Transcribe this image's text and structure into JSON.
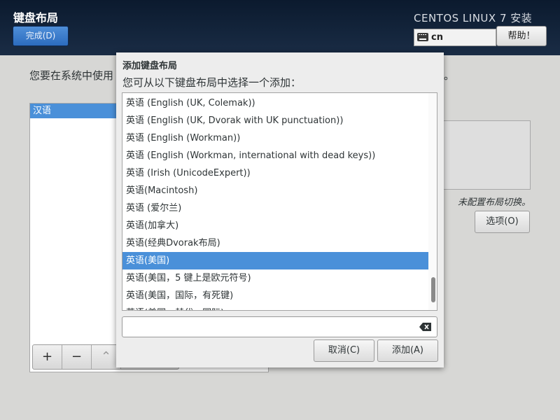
{
  "header": {
    "title": "键盘布局",
    "done_label": "完成(D)",
    "product_title": "CENTOS LINUX 7 安装",
    "keyboard_indicator": "cn",
    "help_label": "帮助！"
  },
  "background": {
    "instruction": "您要在系统中使用",
    "instruction_end": "。",
    "layouts": [
      {
        "label": "汉语"
      }
    ],
    "toolbar": {
      "add": "+",
      "remove": "−",
      "up": "⌃"
    },
    "no_switch_text": "未配置布局切换。",
    "options_label": "选项(O)"
  },
  "dialog": {
    "title": "添加键盘布局",
    "prompt": "您可从以下键盘布局中选择一个添加：",
    "layouts": [
      {
        "label": "英语 (English (UK, Colemak))"
      },
      {
        "label": "英语 (English (UK, Dvorak with UK punctuation))"
      },
      {
        "label": "英语 (English (Workman))"
      },
      {
        "label": "英语 (English (Workman, international with dead keys))"
      },
      {
        "label": "英语 (Irish (UnicodeExpert))"
      },
      {
        "label": "英语(Macintosh)"
      },
      {
        "label": "英语 (爱尔兰)"
      },
      {
        "label": "英语(加拿大)"
      },
      {
        "label": "英语(经典Dvorak布局)"
      },
      {
        "label": "英语(美国)",
        "selected": true
      },
      {
        "label": "英语(美国，5 键上是欧元符号)"
      },
      {
        "label": "英语(美国，国际，有死键)"
      },
      {
        "label": "英语(美国，替代，国际)"
      }
    ],
    "search": {
      "value": "",
      "placeholder": ""
    },
    "cancel_label": "取消(C)",
    "add_label": "添加(A)"
  },
  "colors": {
    "header_bg": "#14253c",
    "selection": "#4a90d9",
    "primary_button": "#2c6cbf"
  }
}
